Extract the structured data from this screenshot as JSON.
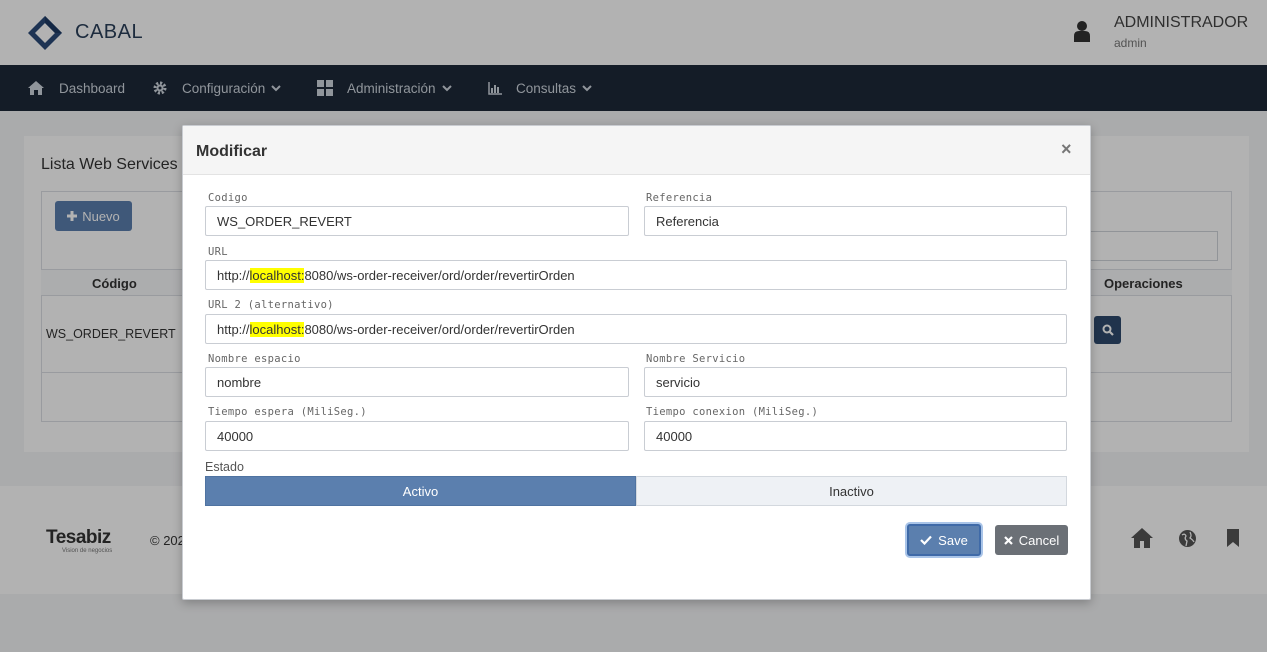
{
  "header": {
    "brand": "CABAL",
    "user_name": "ADMINISTRADOR",
    "user_role": "admin"
  },
  "nav": [
    {
      "label": "Dashboard",
      "icon": "home-icon"
    },
    {
      "label": "Configuración",
      "icon": "gear-icon"
    },
    {
      "label": "Administración",
      "icon": "grid-icon"
    },
    {
      "label": "Consultas",
      "icon": "chart-icon"
    }
  ],
  "page": {
    "title": "Lista Web Services",
    "new_button": "Nuevo",
    "columns": {
      "codigo": "Código",
      "operaciones": "Operaciones"
    },
    "rows": [
      {
        "codigo": "WS_ORDER_REVERT"
      }
    ]
  },
  "footer": {
    "company": "Tesabiz",
    "tagline": "Vision de negocios",
    "copyright": "© 202"
  },
  "modal": {
    "title": "Modificar",
    "close": "×",
    "fields": {
      "codigo": {
        "label": "Codigo",
        "value": "WS_ORDER_REVERT"
      },
      "referencia": {
        "label": "Referencia",
        "value": "Referencia"
      },
      "url": {
        "label": "URL",
        "prefix": "http://",
        "highlight": "localhost:",
        "suffix": "8080/ws-order-receiver/ord/order/revertirOrden"
      },
      "url2": {
        "label": "URL 2 (alternativo)",
        "prefix": "http://",
        "highlight": "localhost:",
        "suffix": "8080/ws-order-receiver/ord/order/revertirOrden"
      },
      "nombre_espacio": {
        "label": "Nombre espacio",
        "value": "nombre"
      },
      "nombre_servicio": {
        "label": "Nombre Servicio",
        "value": "servicio"
      },
      "tiempo_espera": {
        "label": "Tiempo espera (MiliSeg.)",
        "value": "40000"
      },
      "tiempo_conexion": {
        "label": "Tiempo conexion (MiliSeg.)",
        "value": "40000"
      }
    },
    "estado": {
      "label": "Estado",
      "options": [
        "Activo",
        "Inactivo"
      ],
      "selected": "Activo"
    },
    "save": "Save",
    "cancel": "Cancel"
  },
  "colors": {
    "primary": "#5b7fae",
    "navbar": "#1d2938",
    "highlight": "#ffff00",
    "cancel": "#6b7076"
  }
}
